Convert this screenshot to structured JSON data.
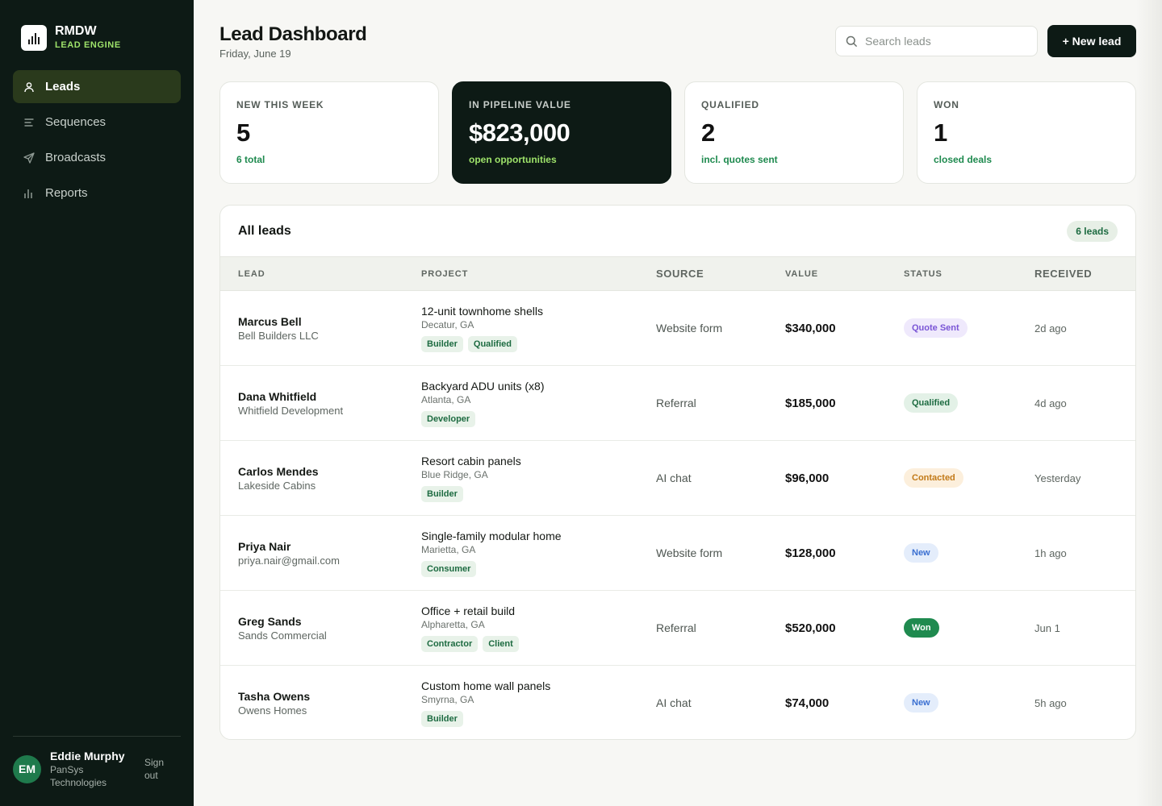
{
  "brand": {
    "name": "RMDW",
    "subtitle": "LEAD ENGINE"
  },
  "nav": [
    {
      "label": "Leads",
      "icon": "user-icon",
      "active": true
    },
    {
      "label": "Sequences",
      "icon": "list-icon",
      "active": false
    },
    {
      "label": "Broadcasts",
      "icon": "send-icon",
      "active": false
    },
    {
      "label": "Reports",
      "icon": "bar-chart-icon",
      "active": false
    }
  ],
  "user": {
    "initials": "EM",
    "name": "Eddie Murphy",
    "org": "PanSys Technologies",
    "signout": "Sign out"
  },
  "header": {
    "title": "Lead Dashboard",
    "date": "Friday, June 19",
    "search_placeholder": "Search leads",
    "new_lead": "+ New lead"
  },
  "stats": [
    {
      "label": "NEW THIS WEEK",
      "value": "5",
      "sub": "6 total"
    },
    {
      "label": "IN PIPELINE VALUE",
      "value": "$823,000",
      "sub": "open opportunities"
    },
    {
      "label": "QUALIFIED",
      "value": "2",
      "sub": "incl. quotes sent"
    },
    {
      "label": "WON",
      "value": "1",
      "sub": "closed deals"
    }
  ],
  "table": {
    "title": "All leads",
    "count": "6 leads",
    "columns": [
      "LEAD",
      "PROJECT",
      "SOURCE",
      "VALUE",
      "STATUS",
      "RECEIVED"
    ],
    "rows": [
      {
        "name": "Marcus Bell",
        "company": "Bell Builders LLC",
        "project": "12-unit townhome shells",
        "location": "Decatur, GA",
        "tags": [
          "Builder",
          "Qualified"
        ],
        "source": "Website form",
        "value": "$340,000",
        "status": "Quote Sent",
        "received": "2d ago"
      },
      {
        "name": "Dana Whitfield",
        "company": "Whitfield Development",
        "project": "Backyard ADU units (x8)",
        "location": "Atlanta, GA",
        "tags": [
          "Developer"
        ],
        "source": "Referral",
        "value": "$185,000",
        "status": "Qualified",
        "received": "4d ago"
      },
      {
        "name": "Carlos Mendes",
        "company": "Lakeside Cabins",
        "project": "Resort cabin panels",
        "location": "Blue Ridge, GA",
        "tags": [
          "Builder"
        ],
        "source": "AI chat",
        "value": "$96,000",
        "status": "Contacted",
        "received": "Yesterday"
      },
      {
        "name": "Priya Nair",
        "company": "priya.nair@gmail.com",
        "project": "Single-family modular home",
        "location": "Marietta, GA",
        "tags": [
          "Consumer"
        ],
        "source": "Website form",
        "value": "$128,000",
        "status": "New",
        "received": "1h ago"
      },
      {
        "name": "Greg Sands",
        "company": "Sands Commercial",
        "project": "Office + retail build",
        "location": "Alpharetta, GA",
        "tags": [
          "Contractor",
          "Client"
        ],
        "source": "Referral",
        "value": "$520,000",
        "status": "Won",
        "received": "Jun 1"
      },
      {
        "name": "Tasha Owens",
        "company": "Owens Homes",
        "project": "Custom home wall panels",
        "location": "Smyrna, GA",
        "tags": [
          "Builder"
        ],
        "source": "AI chat",
        "value": "$74,000",
        "status": "New",
        "received": "5h ago"
      }
    ]
  },
  "colors": {
    "sidebar": "#0d1a15",
    "accent": "#9ee36a",
    "green": "#1f8a4f"
  }
}
